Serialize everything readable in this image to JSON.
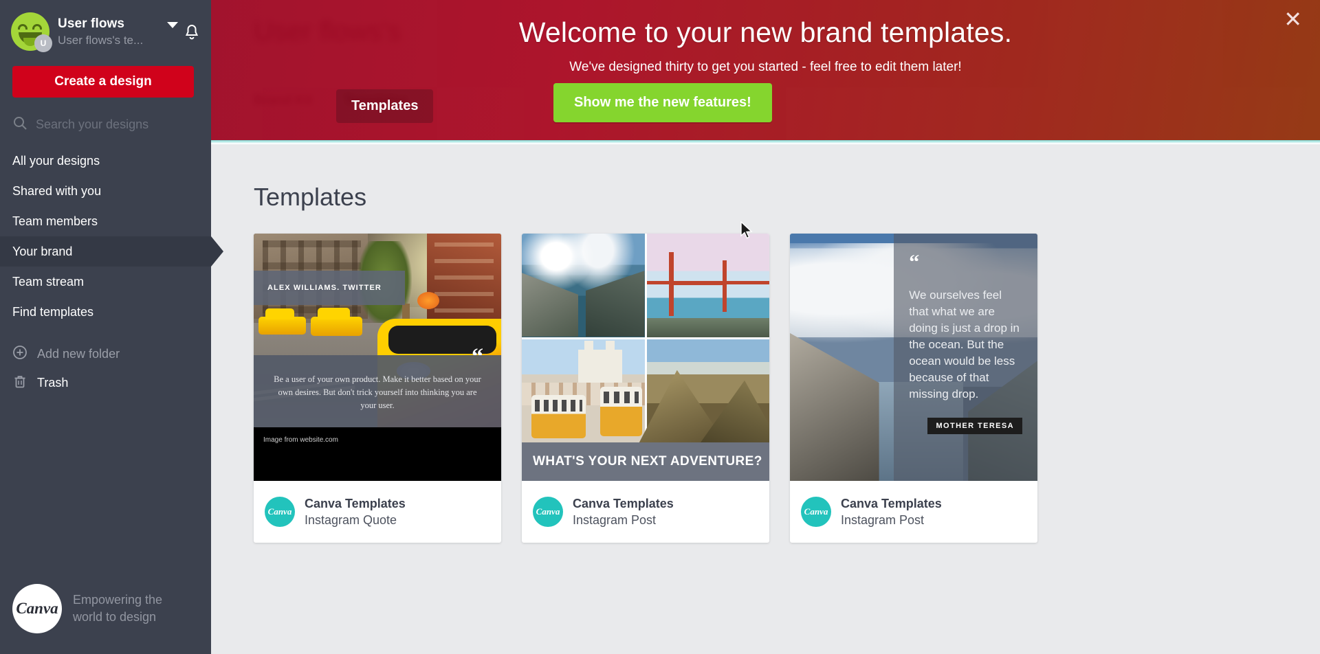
{
  "sidebar": {
    "account": {
      "name": "User flows",
      "team": "User flows's te...",
      "avatar_badge": "U",
      "caret_icon": "chevron-down-icon",
      "bell_icon": "bell-icon"
    },
    "create_button": "Create a design",
    "search": {
      "placeholder": "Search your designs",
      "icon": "search-icon"
    },
    "nav_items": [
      {
        "label": "All your designs",
        "active": false
      },
      {
        "label": "Shared with you",
        "active": false
      },
      {
        "label": "Team members",
        "active": false
      },
      {
        "label": "Your brand",
        "active": true
      },
      {
        "label": "Team stream",
        "active": false
      },
      {
        "label": "Find templates",
        "active": false
      }
    ],
    "actions": [
      {
        "label": "Add new folder",
        "icon": "plus-circle-icon",
        "muted": true
      },
      {
        "label": "Trash",
        "icon": "trash-icon",
        "muted": false
      }
    ],
    "footer": {
      "logo_text": "Canva",
      "tagline": "Empowering the world to design"
    }
  },
  "banner": {
    "title": "Welcome to your new brand templates.",
    "subtitle": "We've designed thirty to get you started - feel free to edit them later!",
    "tab_label": "Templates",
    "cta_label": "Show me the new features!",
    "close_icon": "close-icon",
    "accent_color": "#7ed321",
    "background_color": "#9c0420"
  },
  "underlay": {
    "title": "User flows's",
    "tabs": [
      "Brand Kit",
      "Templates"
    ]
  },
  "main": {
    "page_title": "Templates",
    "cards": [
      {
        "name_bar": "ALEX WILLIAMS. TWITTER",
        "quote": "Be a user of your own product. Make it better based on your own desires. But don't trick yourself into thinking you are your user.",
        "credit": "Image from website.com",
        "quote_mark": "“",
        "author": "Canva Templates",
        "type": "Instagram Quote",
        "badge_text": "Canva"
      },
      {
        "banner_text": "WHAT'S YOUR NEXT ADVENTURE?",
        "author": "Canva Templates",
        "type": "Instagram Post",
        "badge_text": "Canva"
      },
      {
        "quote": "We ourselves feel that what we are doing is just a drop in the ocean. But the ocean would be less because of that missing drop.",
        "quote_mark": "“",
        "attribution": "MOTHER TERESA",
        "author": "Canva Templates",
        "type": "Instagram Post",
        "badge_text": "Canva"
      }
    ]
  }
}
